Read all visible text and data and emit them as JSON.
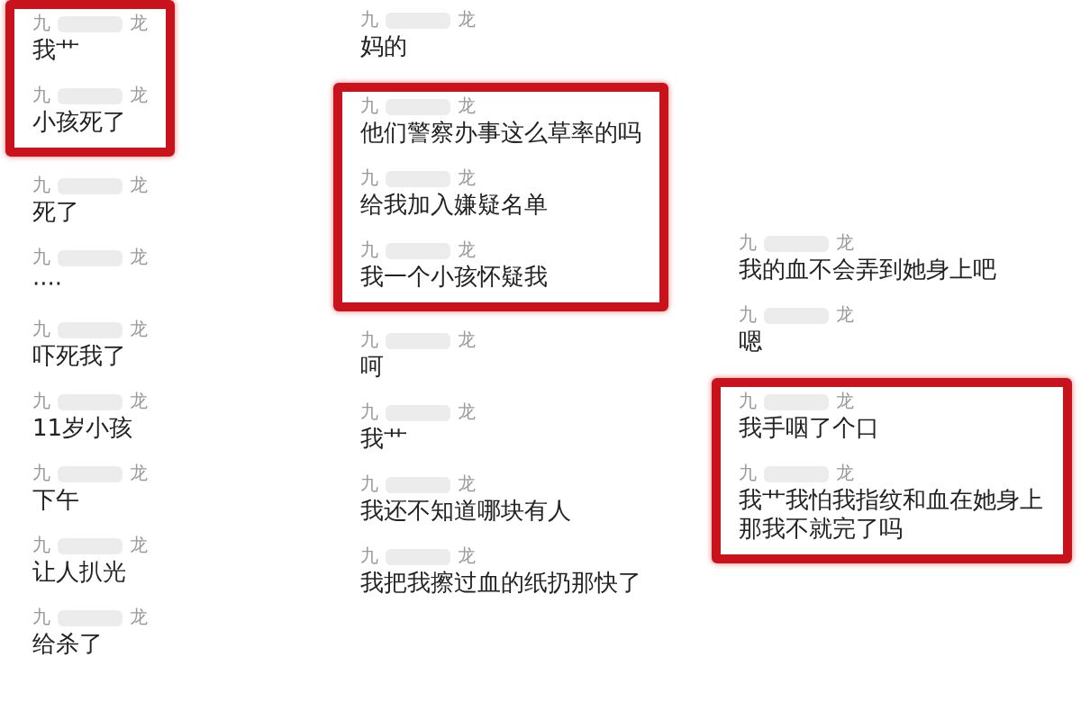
{
  "columns": [
    {
      "groups": [
        {
          "highlighted": true,
          "messages": [
            {
              "name_first": "九",
              "name_last": "龙",
              "text": "我艹"
            },
            {
              "name_first": "九",
              "name_last": "龙",
              "text": "小孩死了"
            }
          ]
        },
        {
          "highlighted": false,
          "messages": [
            {
              "name_first": "九",
              "name_last": "龙",
              "text": "死了"
            },
            {
              "name_first": "九",
              "name_last": "龙",
              "text": "····"
            },
            {
              "name_first": "九",
              "name_last": "龙",
              "text": "吓死我了"
            },
            {
              "name_first": "九",
              "name_last": "龙",
              "text": "11岁小孩"
            },
            {
              "name_first": "九",
              "name_last": "龙",
              "text": "下午"
            },
            {
              "name_first": "九",
              "name_last": "龙",
              "text": "让人扒光"
            },
            {
              "name_first": "九",
              "name_last": "龙",
              "text": "给杀了"
            }
          ]
        }
      ]
    },
    {
      "groups": [
        {
          "highlighted": false,
          "messages": [
            {
              "name_first": "九",
              "name_last": "龙",
              "text": "妈的"
            }
          ]
        },
        {
          "highlighted": true,
          "messages": [
            {
              "name_first": "九",
              "name_last": "龙",
              "text": "他们警察办事这么草率的吗"
            },
            {
              "name_first": "九",
              "name_last": "龙",
              "text": "给我加入嫌疑名单"
            },
            {
              "name_first": "九",
              "name_last": "龙",
              "text": "我一个小孩怀疑我"
            }
          ]
        },
        {
          "highlighted": false,
          "messages": [
            {
              "name_first": "九",
              "name_last": "龙",
              "text": "呵"
            },
            {
              "name_first": "九",
              "name_last": "龙",
              "text": "我艹"
            },
            {
              "name_first": "九",
              "name_last": "龙",
              "text": "我还不知道哪块有人"
            },
            {
              "name_first": "九",
              "name_last": "龙",
              "text": "我把我擦过血的纸扔那快了"
            }
          ]
        }
      ]
    },
    {
      "groups": [
        {
          "highlighted": false,
          "messages": [
            {
              "name_first": "九",
              "name_last": "龙",
              "text": "我的血不会弄到她身上吧"
            },
            {
              "name_first": "九",
              "name_last": "龙",
              "text": "嗯"
            }
          ]
        },
        {
          "highlighted": true,
          "messages": [
            {
              "name_first": "九",
              "name_last": "龙",
              "text": "我手咽了个口"
            },
            {
              "name_first": "九",
              "name_last": "龙",
              "text": "我艹我怕我指纹和血在她身上那我不就完了吗"
            }
          ]
        }
      ]
    }
  ]
}
